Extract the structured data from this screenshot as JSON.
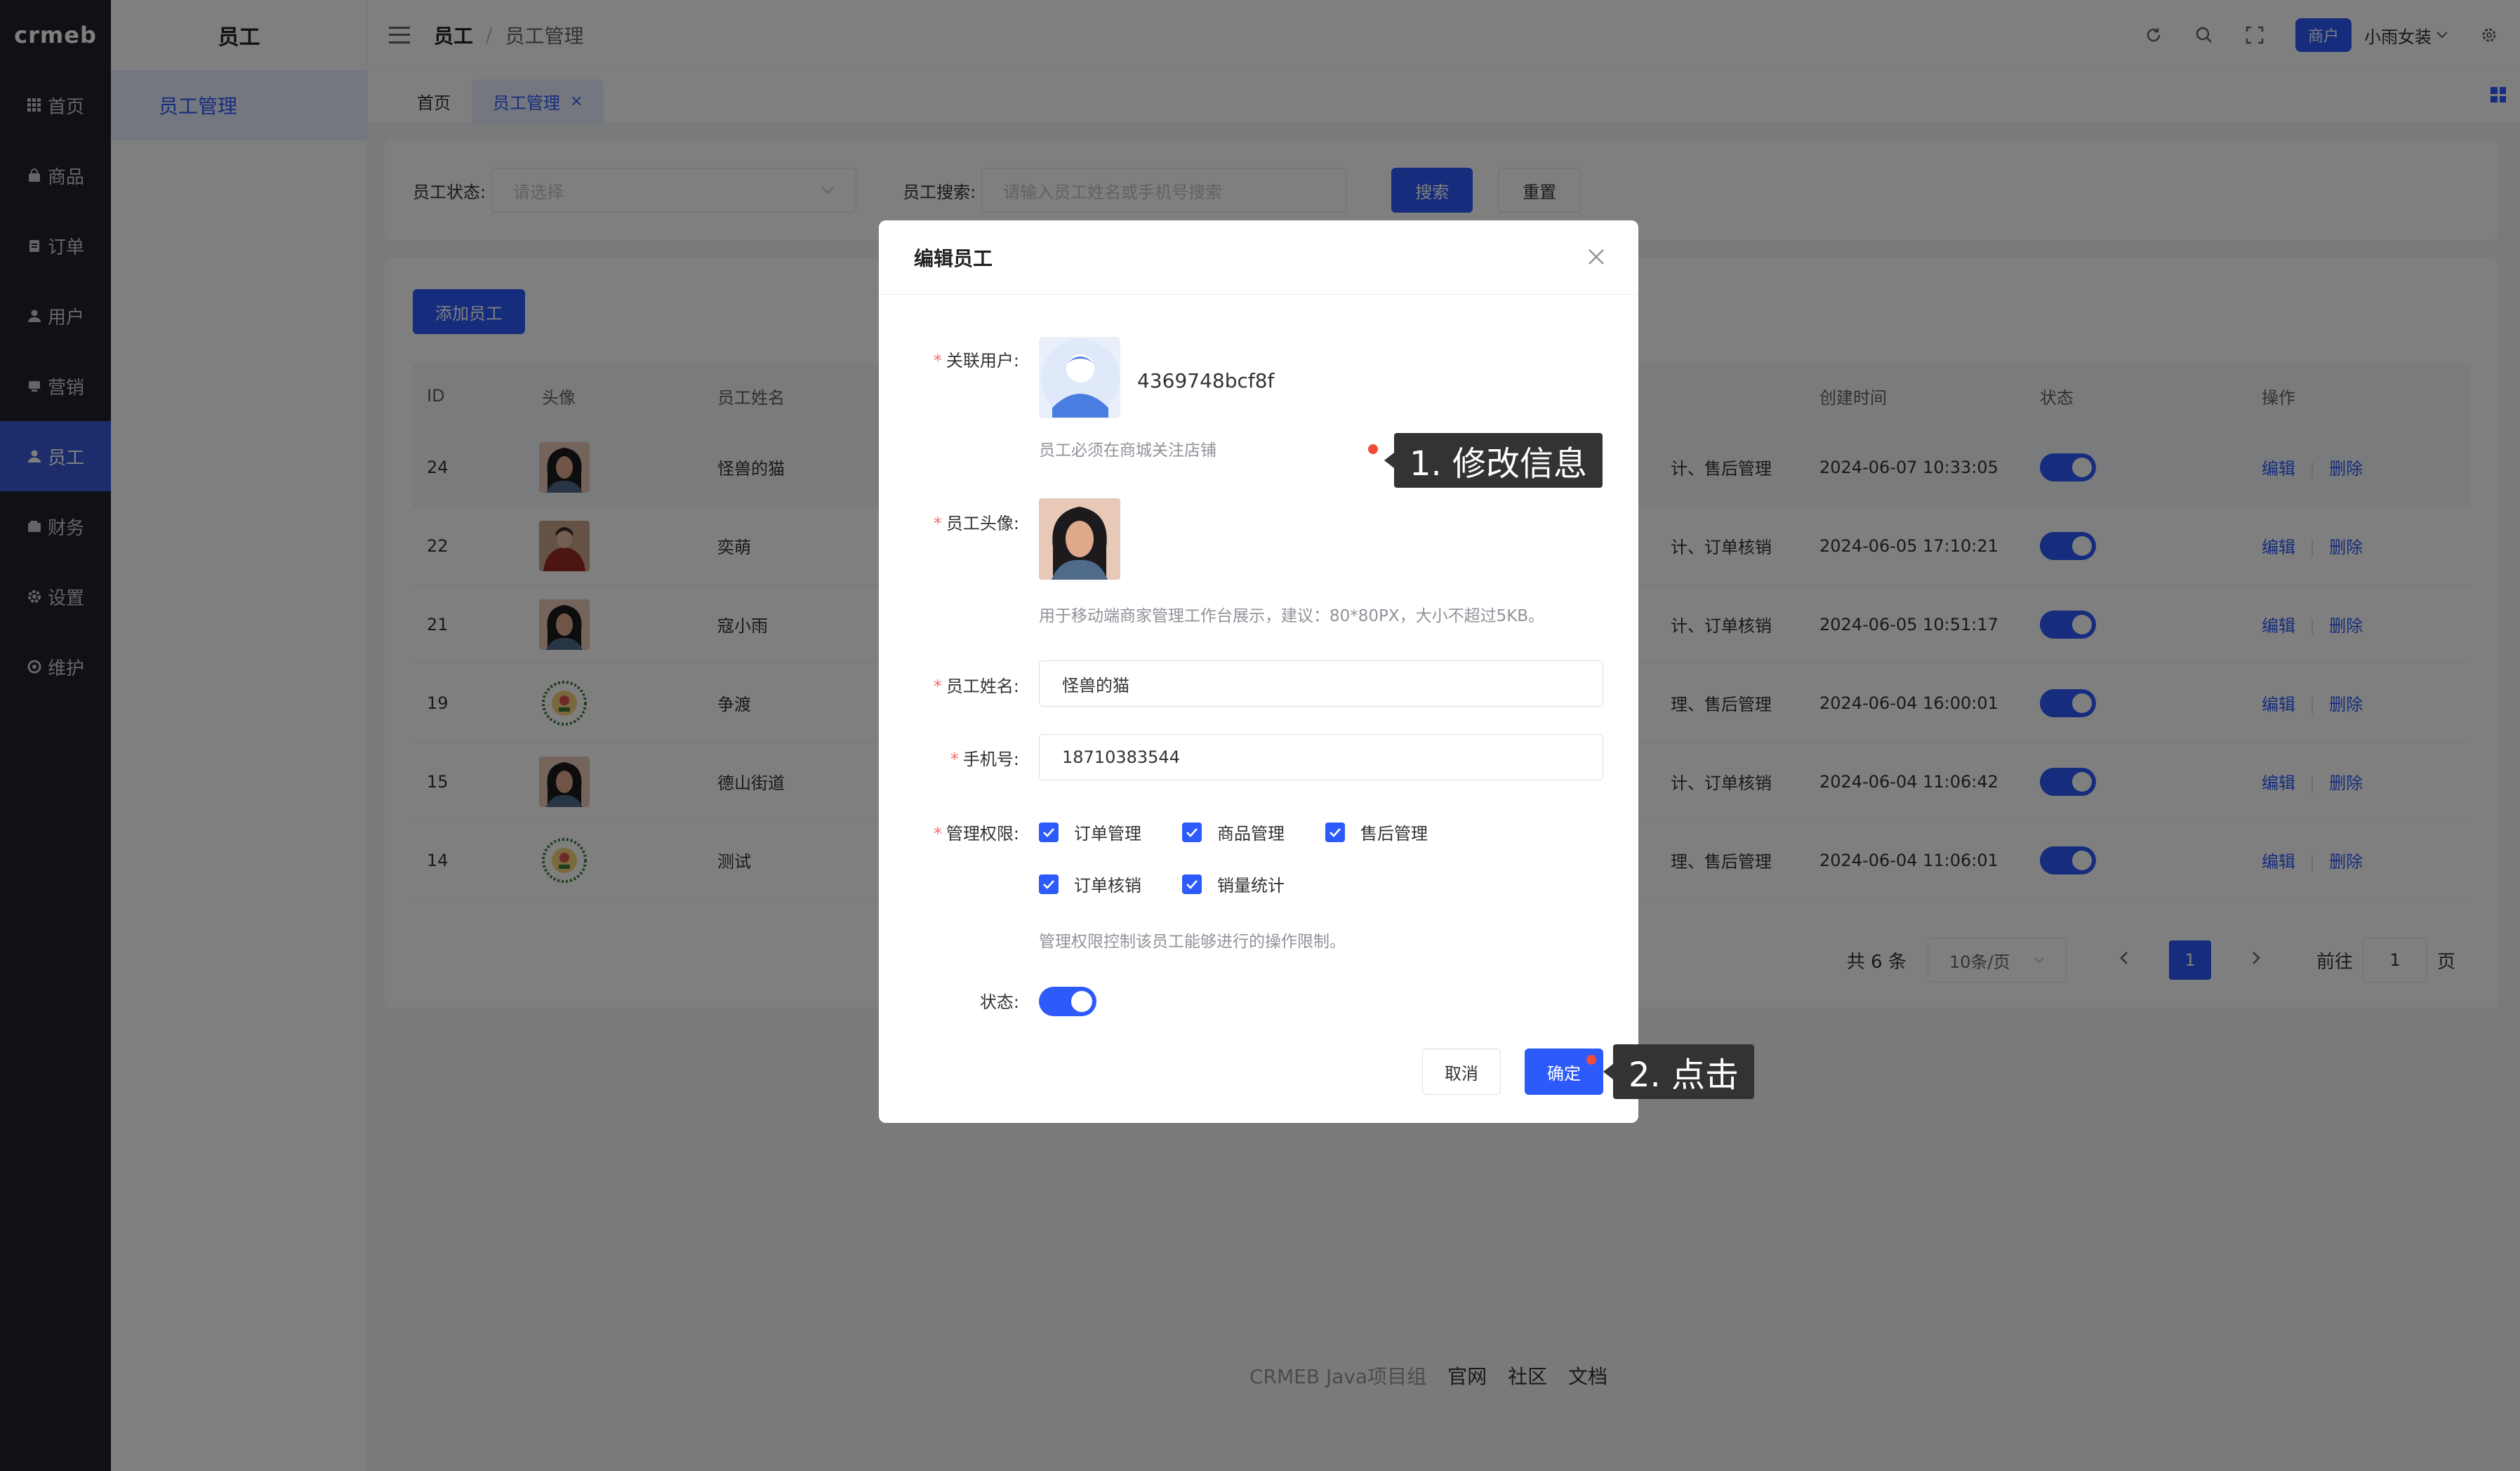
{
  "app": {
    "logo": "crmeb"
  },
  "sidebar": {
    "items": [
      {
        "label": "首页",
        "icon": "grid-icon",
        "active": false
      },
      {
        "label": "商品",
        "icon": "bag-icon",
        "active": false
      },
      {
        "label": "订单",
        "icon": "clipboard-icon",
        "active": false
      },
      {
        "label": "用户",
        "icon": "user-icon",
        "active": false
      },
      {
        "label": "营销",
        "icon": "megaphone-icon",
        "active": false
      },
      {
        "label": "员工",
        "icon": "user-icon",
        "active": true
      },
      {
        "label": "财务",
        "icon": "wallet-icon",
        "active": false
      },
      {
        "label": "设置",
        "icon": "gear-icon",
        "active": false
      },
      {
        "label": "维护",
        "icon": "wrench-icon",
        "active": false
      }
    ]
  },
  "submenu": {
    "title": "员工",
    "items": [
      {
        "label": "员工管理"
      }
    ]
  },
  "header": {
    "breadcrumb": [
      "员工",
      "员工管理"
    ],
    "merchant_badge": "商户",
    "user_name": "小雨女装"
  },
  "tabs": [
    {
      "label": "首页",
      "active": false
    },
    {
      "label": "员工管理",
      "active": true,
      "close": "×"
    }
  ],
  "filter": {
    "status_label": "员工状态:",
    "status_placeholder": "请选择",
    "search_label": "员工搜索:",
    "search_placeholder": "请输入员工姓名或手机号搜索",
    "search_button": "搜索",
    "reset_button": "重置"
  },
  "table": {
    "add_button": "添加员工",
    "headers": [
      "ID",
      "头像",
      "员工姓名",
      "创建时间",
      "状态",
      "操作"
    ],
    "rows": [
      {
        "id": "24",
        "name": "怪兽的猫",
        "perm_tail": "计、售后管理",
        "created": "2024-06-07 10:33:05",
        "edit": "编辑",
        "delete": "删除",
        "avatar": "woman"
      },
      {
        "id": "22",
        "name": "奕萌",
        "perm_tail": "计、订单核销",
        "created": "2024-06-05 17:10:21",
        "edit": "编辑",
        "delete": "删除",
        "avatar": "red"
      },
      {
        "id": "21",
        "name": "寇小雨",
        "perm_tail": "计、订单核销",
        "created": "2024-06-05 10:51:17",
        "edit": "编辑",
        "delete": "删除",
        "avatar": "woman"
      },
      {
        "id": "19",
        "name": "争渡",
        "perm_tail": "理、售后管理",
        "created": "2024-06-04 16:00:01",
        "edit": "编辑",
        "delete": "删除",
        "avatar": "badge"
      },
      {
        "id": "15",
        "name": "德山街道",
        "perm_tail": "计、订单核销",
        "created": "2024-06-04 11:06:42",
        "edit": "编辑",
        "delete": "删除",
        "avatar": "woman"
      },
      {
        "id": "14",
        "name": "测试",
        "perm_tail": "理、售后管理",
        "created": "2024-06-04 11:06:01",
        "edit": "编辑",
        "delete": "删除",
        "avatar": "badge"
      }
    ]
  },
  "pagination": {
    "total": "共 6 条",
    "page_size": "10条/页",
    "current": "1",
    "goto_label": "前往",
    "goto_value": "1",
    "page_unit": "页"
  },
  "footer": {
    "org": "CRMEB Java项目组",
    "links": [
      "官网",
      "社区",
      "文档"
    ]
  },
  "modal": {
    "title": "编辑员工",
    "linked_user_label": "关联用户:",
    "linked_user_id": "4369748bcf8f",
    "linked_user_hint": "员工必须在商城关注店铺",
    "avatar_label": "员工头像:",
    "avatar_hint": "用于移动端商家管理工作台展示，建议：80*80PX，大小不超过5KB。",
    "name_label": "员工姓名:",
    "name_value": "怪兽的猫",
    "phone_label": "手机号:",
    "phone_value": "18710383544",
    "perm_label": "管理权限:",
    "permissions": [
      "订单管理",
      "商品管理",
      "售后管理",
      "订单核销",
      "销量统计"
    ],
    "perm_hint": "管理权限控制该员工能够进行的操作限制。",
    "status_label": "状态:",
    "cancel": "取消",
    "confirm": "确定"
  },
  "annotations": [
    "1. 修改信息",
    "2. 点击"
  ],
  "colors": {
    "primary": "#2d5afa",
    "sidebar_bg": "#1e222b",
    "annotation_dot": "#f04c3a"
  }
}
